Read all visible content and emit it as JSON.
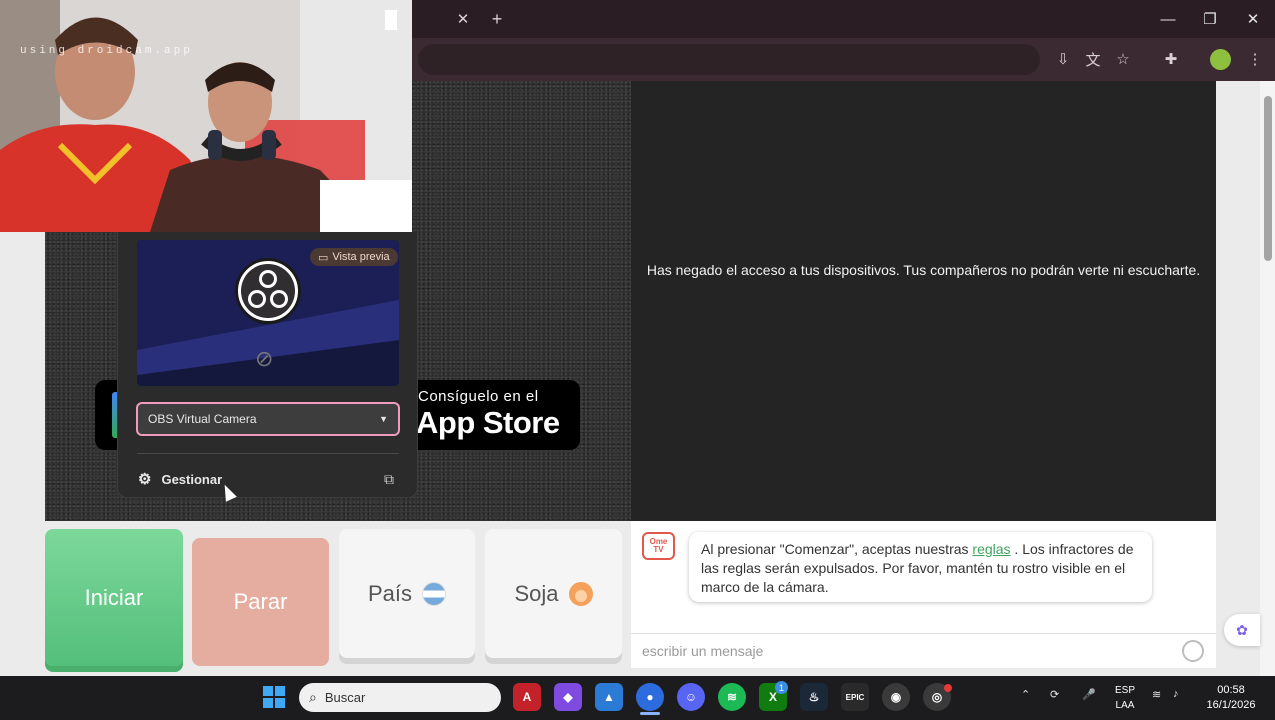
{
  "browser": {
    "tab_close": "✕",
    "new_tab": "+",
    "window": {
      "minimize": "—",
      "restore": "❐",
      "close": "✕"
    },
    "toolbar_icons": [
      "install-icon",
      "translate-icon",
      "star-icon",
      "extensions-icon",
      "profile-icon",
      "menu-icon"
    ]
  },
  "webcam": {
    "overlay_text": "using droidcam.app"
  },
  "remote": {
    "denied_message": "Has negado el acceso a tus dispositivos. Tus compañeros no podrán verte ni escucharte."
  },
  "badges": {
    "appstore_small": "Consíguelo en el",
    "appstore_big": "App Store"
  },
  "camera_popup": {
    "preview_label": "Vista previa",
    "selected_camera": "OBS Virtual Camera",
    "manage_label": "Gestionar"
  },
  "controls": {
    "start": "Iniciar",
    "stop": "Parar",
    "country": "País",
    "gender": "Soja"
  },
  "chat": {
    "logo_text": "Ome TV",
    "message_before": "Al presionar \"Comenzar\", aceptas nuestras ",
    "rules_link": "reglas",
    "message_after": " . Los infractores de las reglas serán expulsados. Por favor, mantén tu rostro visible en el marco de la cámara.",
    "input_placeholder": "escribir un mensaje"
  },
  "taskbar": {
    "search_placeholder": "Buscar",
    "lang_line1": "ESP",
    "lang_line2": "LAA",
    "time": "00:58",
    "date": "16/1/2026",
    "xbox_badge": "1"
  },
  "colors": {
    "accent_pink": "#ee9bbd",
    "start_green": "#54bf7b",
    "stop_salmon": "#e5aca0",
    "link_green": "#3fa35f"
  }
}
